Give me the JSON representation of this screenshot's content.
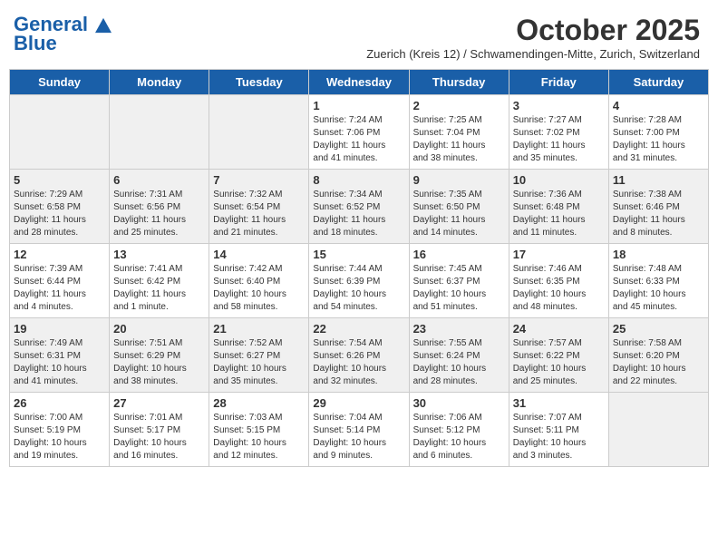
{
  "header": {
    "logo_line1": "General",
    "logo_line2": "Blue",
    "month": "October 2025",
    "location": "Zuerich (Kreis 12) / Schwamendingen-Mitte, Zurich, Switzerland"
  },
  "days_of_week": [
    "Sunday",
    "Monday",
    "Tuesday",
    "Wednesday",
    "Thursday",
    "Friday",
    "Saturday"
  ],
  "weeks": [
    [
      {
        "day": "",
        "info": ""
      },
      {
        "day": "",
        "info": ""
      },
      {
        "day": "",
        "info": ""
      },
      {
        "day": "1",
        "info": "Sunrise: 7:24 AM\nSunset: 7:06 PM\nDaylight: 11 hours\nand 41 minutes."
      },
      {
        "day": "2",
        "info": "Sunrise: 7:25 AM\nSunset: 7:04 PM\nDaylight: 11 hours\nand 38 minutes."
      },
      {
        "day": "3",
        "info": "Sunrise: 7:27 AM\nSunset: 7:02 PM\nDaylight: 11 hours\nand 35 minutes."
      },
      {
        "day": "4",
        "info": "Sunrise: 7:28 AM\nSunset: 7:00 PM\nDaylight: 11 hours\nand 31 minutes."
      }
    ],
    [
      {
        "day": "5",
        "info": "Sunrise: 7:29 AM\nSunset: 6:58 PM\nDaylight: 11 hours\nand 28 minutes."
      },
      {
        "day": "6",
        "info": "Sunrise: 7:31 AM\nSunset: 6:56 PM\nDaylight: 11 hours\nand 25 minutes."
      },
      {
        "day": "7",
        "info": "Sunrise: 7:32 AM\nSunset: 6:54 PM\nDaylight: 11 hours\nand 21 minutes."
      },
      {
        "day": "8",
        "info": "Sunrise: 7:34 AM\nSunset: 6:52 PM\nDaylight: 11 hours\nand 18 minutes."
      },
      {
        "day": "9",
        "info": "Sunrise: 7:35 AM\nSunset: 6:50 PM\nDaylight: 11 hours\nand 14 minutes."
      },
      {
        "day": "10",
        "info": "Sunrise: 7:36 AM\nSunset: 6:48 PM\nDaylight: 11 hours\nand 11 minutes."
      },
      {
        "day": "11",
        "info": "Sunrise: 7:38 AM\nSunset: 6:46 PM\nDaylight: 11 hours\nand 8 minutes."
      }
    ],
    [
      {
        "day": "12",
        "info": "Sunrise: 7:39 AM\nSunset: 6:44 PM\nDaylight: 11 hours\nand 4 minutes."
      },
      {
        "day": "13",
        "info": "Sunrise: 7:41 AM\nSunset: 6:42 PM\nDaylight: 11 hours\nand 1 minute."
      },
      {
        "day": "14",
        "info": "Sunrise: 7:42 AM\nSunset: 6:40 PM\nDaylight: 10 hours\nand 58 minutes."
      },
      {
        "day": "15",
        "info": "Sunrise: 7:44 AM\nSunset: 6:39 PM\nDaylight: 10 hours\nand 54 minutes."
      },
      {
        "day": "16",
        "info": "Sunrise: 7:45 AM\nSunset: 6:37 PM\nDaylight: 10 hours\nand 51 minutes."
      },
      {
        "day": "17",
        "info": "Sunrise: 7:46 AM\nSunset: 6:35 PM\nDaylight: 10 hours\nand 48 minutes."
      },
      {
        "day": "18",
        "info": "Sunrise: 7:48 AM\nSunset: 6:33 PM\nDaylight: 10 hours\nand 45 minutes."
      }
    ],
    [
      {
        "day": "19",
        "info": "Sunrise: 7:49 AM\nSunset: 6:31 PM\nDaylight: 10 hours\nand 41 minutes."
      },
      {
        "day": "20",
        "info": "Sunrise: 7:51 AM\nSunset: 6:29 PM\nDaylight: 10 hours\nand 38 minutes."
      },
      {
        "day": "21",
        "info": "Sunrise: 7:52 AM\nSunset: 6:27 PM\nDaylight: 10 hours\nand 35 minutes."
      },
      {
        "day": "22",
        "info": "Sunrise: 7:54 AM\nSunset: 6:26 PM\nDaylight: 10 hours\nand 32 minutes."
      },
      {
        "day": "23",
        "info": "Sunrise: 7:55 AM\nSunset: 6:24 PM\nDaylight: 10 hours\nand 28 minutes."
      },
      {
        "day": "24",
        "info": "Sunrise: 7:57 AM\nSunset: 6:22 PM\nDaylight: 10 hours\nand 25 minutes."
      },
      {
        "day": "25",
        "info": "Sunrise: 7:58 AM\nSunset: 6:20 PM\nDaylight: 10 hours\nand 22 minutes."
      }
    ],
    [
      {
        "day": "26",
        "info": "Sunrise: 7:00 AM\nSunset: 5:19 PM\nDaylight: 10 hours\nand 19 minutes."
      },
      {
        "day": "27",
        "info": "Sunrise: 7:01 AM\nSunset: 5:17 PM\nDaylight: 10 hours\nand 16 minutes."
      },
      {
        "day": "28",
        "info": "Sunrise: 7:03 AM\nSunset: 5:15 PM\nDaylight: 10 hours\nand 12 minutes."
      },
      {
        "day": "29",
        "info": "Sunrise: 7:04 AM\nSunset: 5:14 PM\nDaylight: 10 hours\nand 9 minutes."
      },
      {
        "day": "30",
        "info": "Sunrise: 7:06 AM\nSunset: 5:12 PM\nDaylight: 10 hours\nand 6 minutes."
      },
      {
        "day": "31",
        "info": "Sunrise: 7:07 AM\nSunset: 5:11 PM\nDaylight: 10 hours\nand 3 minutes."
      },
      {
        "day": "",
        "info": ""
      }
    ]
  ]
}
